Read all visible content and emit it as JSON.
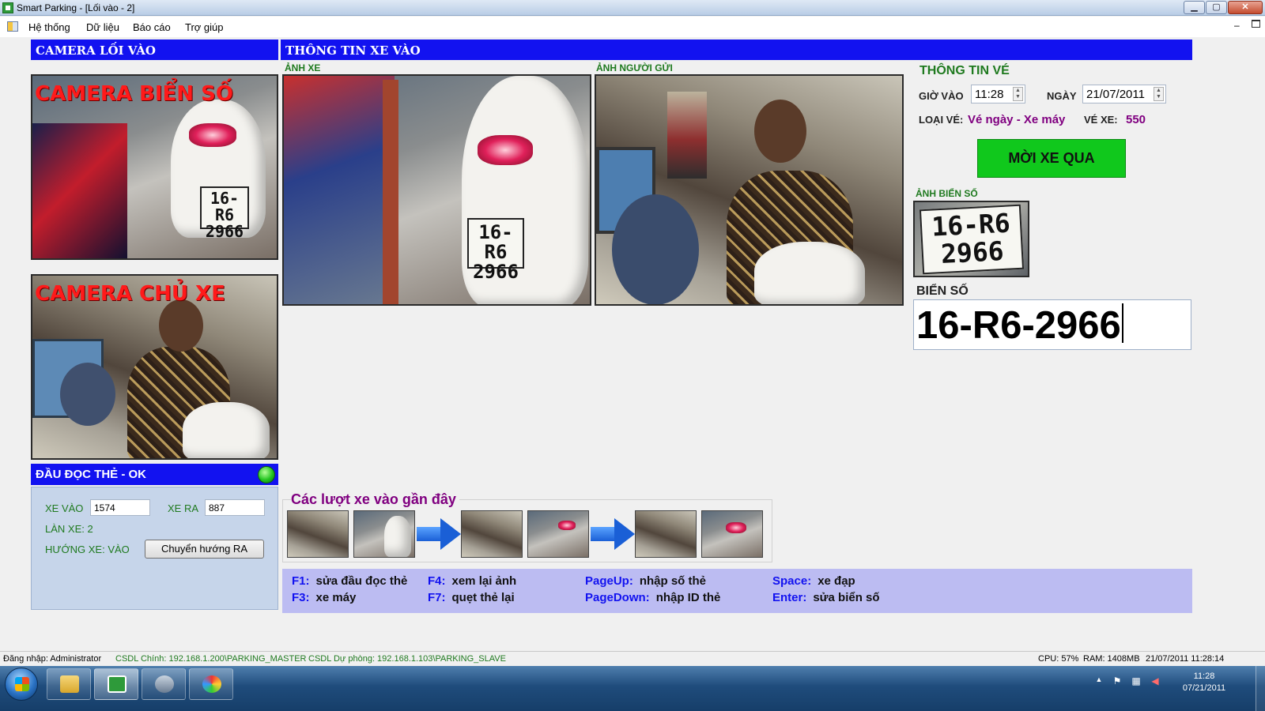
{
  "window": {
    "title": "Smart Parking - [Lối vào - 2]",
    "min_glyph": "▁",
    "max_glyph": "▢",
    "close_glyph": "✕"
  },
  "menu": {
    "items": [
      "Hệ thống",
      "Dữ liệu",
      "Báo cáo",
      "Trợ giúp"
    ],
    "mdi_min_glyph": "–"
  },
  "left_panel": {
    "header": "CAMERA LỐI VÀO",
    "camera_plate_caption": "CAMERA BIỂN SỐ",
    "camera_owner_caption": "CAMERA CHỦ XE",
    "reader_status": "ĐẦU ĐỌC THẺ - OK",
    "reader_status_color": "#22c41f",
    "xe_vao_label": "XE VÀO",
    "xe_vao_value": "1574",
    "xe_ra_label": "XE RA",
    "xe_ra_value": "887",
    "lane": "LÀN XE: 2",
    "direction": "HƯỚNG XE: VÀO",
    "switch_button": "Chuyển hướng RA"
  },
  "main": {
    "header": "THÔNG TIN XE VÀO",
    "vehicle_photo_label": "ẢNH XE",
    "sender_photo_label": "ẢNH NGƯỜI GỬI",
    "plate_on_photo_line1": "16-R6",
    "plate_on_photo_line2": "2966"
  },
  "ticket": {
    "title": "THÔNG TIN VÉ",
    "time_label": "GIỜ VÀO",
    "time_value": "11:28",
    "date_label": "NGÀY",
    "date_value": "21/07/2011",
    "type_label": "LOẠI VÉ:",
    "type_value": "Vé ngày - Xe máy",
    "ticket_no_label": "VÉ XE:",
    "ticket_no_value": "550",
    "go_button": "MỜI XE QUA",
    "go_button_color": "#10c81c",
    "plate_photo_label": "ẢNH BIỂN SỐ",
    "plate_label": "BIỂN SỐ",
    "plate_value": "16-R6-2966"
  },
  "recent": {
    "title": "Các lượt xe vào gần đây"
  },
  "shortcuts": [
    {
      "key": "F1:",
      "action": "sửa đầu đọc thẻ"
    },
    {
      "key": "F3:",
      "action": "xe máy"
    },
    {
      "key": "F4:",
      "action": "xem lại ảnh"
    },
    {
      "key": "F7:",
      "action": "quẹt thẻ lại"
    },
    {
      "key": "PageUp:",
      "action": "nhập số thẻ"
    },
    {
      "key": "PageDown:",
      "action": "nhập ID thẻ"
    },
    {
      "key": "Space:",
      "action": "xe đạp"
    },
    {
      "key": "Enter:",
      "action": "sửa biển số"
    }
  ],
  "statusbar": {
    "login": "Đăng nhập: Administrator",
    "db_main": "CSDL Chính: 192.168.1.200\\PARKING_MASTER",
    "db_backup": "CSDL Dự phòng: 192.168.1.103\\PARKING_SLAVE",
    "cpu": "CPU: 57%",
    "ram": "RAM: 1408MB",
    "datetime": "21/07/2011 11:28:14"
  },
  "taskbar": {
    "clock_time": "11:28",
    "clock_date": "07/21/2011",
    "tray_up_glyph": "▲",
    "tray_flag_glyph": "⚑",
    "tray_net_glyph": "▦",
    "tray_sound_glyph": "◀"
  },
  "colors": {
    "header_blue": "#1212f0",
    "label_green": "#1f7a1f",
    "purple": "#800080",
    "shortcut_bg": "#bcbcf2"
  }
}
